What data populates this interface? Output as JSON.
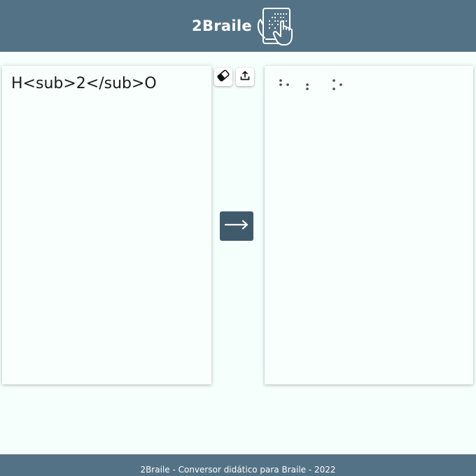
{
  "header": {
    "title": "2Braile",
    "logo_icon": "braille-tablet-hand-icon",
    "background": "#537286"
  },
  "input_panel": {
    "value": "H<sub>2</sub>O"
  },
  "output_panel": {
    "braille": "⠓⠆⠕",
    "cells": [
      {
        "char": "H",
        "dots": [
          1,
          2,
          5
        ]
      },
      {
        "char": "2",
        "dots": [
          2,
          3
        ]
      },
      {
        "char": "O",
        "dots": [
          1,
          3,
          5
        ]
      }
    ]
  },
  "toolbar": {
    "clear_icon": "eraser-icon",
    "upload_icon": "upload-icon"
  },
  "convert_button": {
    "icon": "arrow-right-icon",
    "color": "#3f5a6b"
  },
  "footer": {
    "text": "2Braile - Conversor didático para Braile - 2022"
  }
}
